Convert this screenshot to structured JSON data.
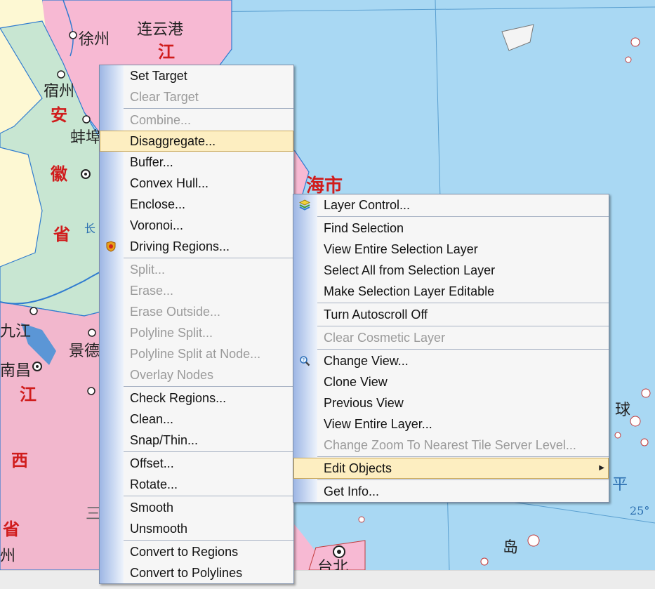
{
  "map": {
    "labels": {
      "xuzhou": "徐州",
      "lianyungang": "连云港",
      "jiang_top": "江",
      "suzhou": "宿州",
      "an": "安",
      "bengbu": "蚌埠",
      "hui": "徽",
      "sheng1": "省",
      "chang": "长",
      "shanghai": "海市",
      "jiujiang": "九江",
      "jingde": "景德",
      "nanchang": "南昌",
      "jiang2": "江",
      "xi": "西",
      "sheng2": "省",
      "zhou": "州",
      "san": "三",
      "qiu": "球",
      "ping": "平",
      "dao": "岛",
      "taibei": "台北",
      "lat25": "25°"
    },
    "colors": {
      "sea": "#a9d8f3",
      "anhui": "#c8e6d2",
      "jiangsu": "#f7b9d3",
      "jiangxi": "#f2b7cd",
      "henan": "#fdf8d3",
      "boundary": "#2f7bd0"
    }
  },
  "context_menu": {
    "items": [
      {
        "label": "Set Target",
        "enabled": true
      },
      {
        "label": "Clear Target",
        "enabled": false
      },
      {
        "separator": true
      },
      {
        "label": "Combine...",
        "enabled": false
      },
      {
        "label": "Disaggregate...",
        "enabled": true,
        "highlighted": true
      },
      {
        "label": "Buffer...",
        "enabled": true
      },
      {
        "label": "Convex Hull...",
        "enabled": true
      },
      {
        "label": "Enclose...",
        "enabled": true
      },
      {
        "label": "Voronoi...",
        "enabled": true
      },
      {
        "label": "Driving Regions...",
        "enabled": true,
        "icon": "driving-regions-icon"
      },
      {
        "separator": true
      },
      {
        "label": "Split...",
        "enabled": false
      },
      {
        "label": "Erase...",
        "enabled": false
      },
      {
        "label": "Erase Outside...",
        "enabled": false
      },
      {
        "label": "Polyline Split...",
        "enabled": false
      },
      {
        "label": "Polyline Split at Node...",
        "enabled": false
      },
      {
        "label": "Overlay Nodes",
        "enabled": false
      },
      {
        "separator": true
      },
      {
        "label": "Check Regions...",
        "enabled": true
      },
      {
        "label": "Clean...",
        "enabled": true
      },
      {
        "label": "Snap/Thin...",
        "enabled": true
      },
      {
        "separator": true
      },
      {
        "label": "Offset...",
        "enabled": true
      },
      {
        "label": "Rotate...",
        "enabled": true
      },
      {
        "separator": true
      },
      {
        "label": "Smooth",
        "enabled": true
      },
      {
        "label": "Unsmooth",
        "enabled": true
      },
      {
        "separator": true
      },
      {
        "label": "Convert to Regions",
        "enabled": true
      },
      {
        "label": "Convert to Polylines",
        "enabled": true
      }
    ]
  },
  "sub_menu": {
    "items": [
      {
        "label": "Layer Control...",
        "enabled": true,
        "icon": "layer-control-icon"
      },
      {
        "separator": true
      },
      {
        "label": "Find Selection",
        "enabled": true
      },
      {
        "label": "View Entire Selection Layer",
        "enabled": true
      },
      {
        "label": "Select All from Selection Layer",
        "enabled": true
      },
      {
        "label": "Make Selection Layer Editable",
        "enabled": true
      },
      {
        "separator": true
      },
      {
        "label": "Turn Autoscroll Off",
        "enabled": true
      },
      {
        "separator": true
      },
      {
        "label": "Clear Cosmetic Layer",
        "enabled": false
      },
      {
        "separator": true
      },
      {
        "label": "Change View...",
        "enabled": true,
        "icon": "change-view-icon"
      },
      {
        "label": "Clone View",
        "enabled": true
      },
      {
        "label": "Previous View",
        "enabled": true
      },
      {
        "label": "View Entire Layer...",
        "enabled": true
      },
      {
        "label": "Change Zoom To Nearest Tile Server Level...",
        "enabled": false
      },
      {
        "separator": true
      },
      {
        "label": "Edit Objects",
        "enabled": true,
        "highlighted": true,
        "submenu": true
      },
      {
        "separator": true
      },
      {
        "label": "Get Info...",
        "enabled": true
      }
    ]
  }
}
